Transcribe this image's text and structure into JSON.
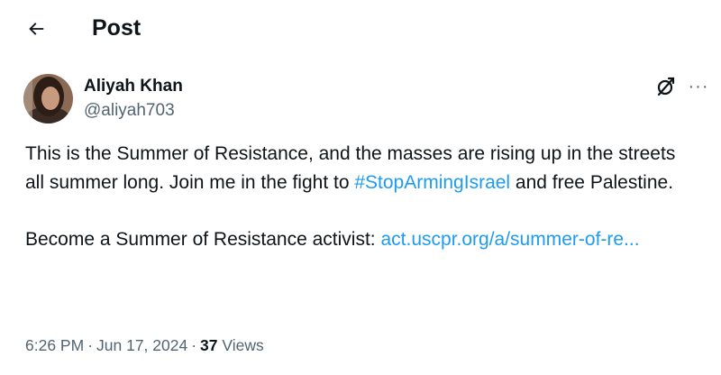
{
  "header": {
    "title": "Post",
    "back_icon": "arrow-left-icon"
  },
  "author": {
    "name": "Aliyah Khan",
    "handle": "@aliyah703"
  },
  "actions": {
    "grok_icon": "grok-icon",
    "more_label": "···"
  },
  "post": {
    "text_1": "This is the Summer of Resistance, and the masses are rising up in the streets all summer long. Join me in the fight to ",
    "hashtag": "#StopArmingIsrael",
    "text_2": " and free Palestine.",
    "text_3": "Become a Summer of Resistance activist: ",
    "link": "act.uscpr.org/a/summer-of-re..."
  },
  "meta": {
    "time": "6:26 PM",
    "separator": "·",
    "date": "Jun 17, 2024",
    "views_count": "37",
    "views_label": "Views"
  },
  "colors": {
    "accent": "#1d9bf0",
    "text_primary": "#0f1419",
    "text_secondary": "#536471"
  }
}
